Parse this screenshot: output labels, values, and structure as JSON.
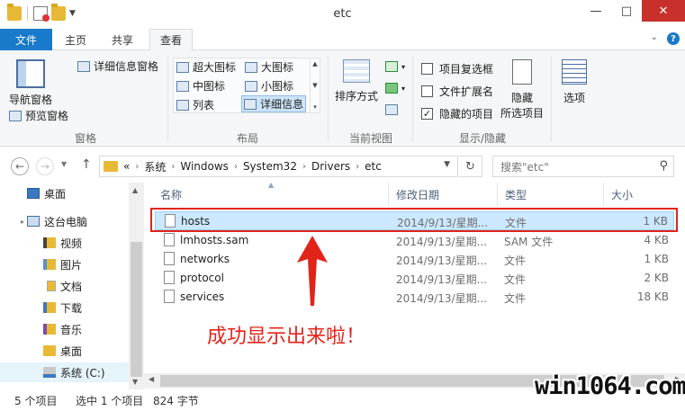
{
  "window": {
    "title": "etc"
  },
  "tabs": {
    "file": "文件",
    "home": "主页",
    "share": "共享",
    "view": "查看"
  },
  "ribbon": {
    "panes": {
      "nav_pane": "导航窗格",
      "preview_pane": "预览窗格",
      "details_pane": "详细信息窗格",
      "group": "窗格"
    },
    "layout": {
      "extra_large": "超大图标",
      "large": "大图标",
      "medium": "中图标",
      "small": "小图标",
      "list": "列表",
      "details": "详细信息",
      "group": "布局"
    },
    "current_view": {
      "sort_by": "排序方式",
      "group": "当前视图"
    },
    "show_hide": {
      "item_checkboxes": {
        "label": "项目复选框",
        "checked": false
      },
      "file_extensions": {
        "label": "文件扩展名",
        "checked": false
      },
      "hidden_items": {
        "label": "隐藏的项目",
        "checked": true
      },
      "hide_selected_1": "隐藏",
      "hide_selected_2": "所选项目",
      "group": "显示/隐藏"
    },
    "options": "选项"
  },
  "address": {
    "overflow": "«",
    "crumbs": [
      "系统",
      "Windows",
      "System32",
      "Drivers",
      "etc"
    ],
    "search_placeholder": "搜索\"etc\""
  },
  "nav_pane": {
    "items": [
      {
        "label": "桌面",
        "icon": "desktop-icon"
      },
      {
        "label": "这台电脑",
        "icon": "computer-icon"
      },
      {
        "label": "视频",
        "icon": "videos-folder-icon"
      },
      {
        "label": "图片",
        "icon": "pictures-folder-icon"
      },
      {
        "label": "文档",
        "icon": "documents-folder-icon"
      },
      {
        "label": "下载",
        "icon": "downloads-folder-icon"
      },
      {
        "label": "音乐",
        "icon": "music-folder-icon"
      },
      {
        "label": "桌面",
        "icon": "desktop-folder-icon"
      },
      {
        "label": "系统 (C:)",
        "icon": "drive-icon"
      }
    ]
  },
  "file_list": {
    "columns": {
      "name": "名称",
      "modified": "修改日期",
      "type": "类型",
      "size": "大小"
    },
    "rows": [
      {
        "name": "hosts",
        "modified": "2014/9/13/星期...",
        "type": "文件",
        "size": "1 KB",
        "selected": true
      },
      {
        "name": "lmhosts.sam",
        "modified": "2014/9/13/星期...",
        "type": "SAM 文件",
        "size": "4 KB",
        "selected": false
      },
      {
        "name": "networks",
        "modified": "2014/9/13/星期...",
        "type": "文件",
        "size": "1 KB",
        "selected": false
      },
      {
        "name": "protocol",
        "modified": "2014/9/13/星期...",
        "type": "文件",
        "size": "2 KB",
        "selected": false
      },
      {
        "name": "services",
        "modified": "2014/9/13/星期...",
        "type": "文件",
        "size": "18 KB",
        "selected": false
      }
    ]
  },
  "annotation": {
    "text": "成功显示出来啦！",
    "color": "#e2231a"
  },
  "status": {
    "item_count": "5 个项目",
    "selection": "选中 1 个项目",
    "selection_size": "824 字节"
  },
  "watermark": "win1064.com",
  "colors": {
    "accent": "#1979ca",
    "selection": "#cce8ff",
    "highlight_box": "#e2231a"
  }
}
